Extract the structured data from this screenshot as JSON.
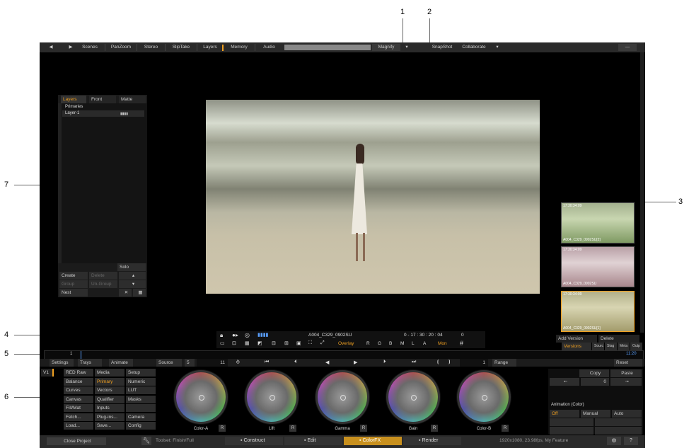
{
  "callouts": [
    "1",
    "2",
    "3",
    "4",
    "5",
    "6",
    "7"
  ],
  "topbar": {
    "items": [
      "Scenes",
      "PanZoom",
      "Stereo",
      "SlipTake",
      "Layers",
      "Memory",
      "Audio"
    ],
    "magnify": "Magnify",
    "snapshot": "SnapShot",
    "collaborate": "Collaborate"
  },
  "layers_panel": {
    "tabs": [
      "Layers",
      "Front",
      "Matte"
    ],
    "rows": [
      "Primaries",
      "Layer-1"
    ],
    "solo": "Solo",
    "create": "Create",
    "delete": "Delete",
    "group": "Group",
    "ungroup": "Un-Group",
    "nest": "Nest"
  },
  "viewer": {
    "clip_name": "A004_C329_0902SU",
    "timecode": "0 - 17 : 30 : 20 : 04",
    "frame": "0",
    "overlay": "Overlay",
    "channels": [
      "R",
      "G",
      "B",
      "M",
      "L",
      "A"
    ],
    "mon": "Mon"
  },
  "versions": {
    "add_version": "Add Version",
    "delete": "Delete",
    "tabs": [
      "Versions",
      "Sourc",
      "Stag",
      "Meta",
      "Outp"
    ],
    "thumbs": [
      {
        "tc": "17:30:34:09",
        "name": "A004_C329_0902SU[2]"
      },
      {
        "tc": "17:30:34:09",
        "name": "A004_C329_0902SU"
      },
      {
        "tc": "17:30:34:09",
        "name": "A004_C329_0902SU[1]"
      }
    ]
  },
  "timeline": {
    "frame": "1",
    "end": "11:20"
  },
  "transport": {
    "tabs": [
      "Settings",
      "Trays",
      "Animate"
    ],
    "source": "Source",
    "source_num": "5",
    "frame": "11",
    "range": "Range",
    "range_num": "1",
    "reset": "Reset"
  },
  "menu": {
    "v1": "V1",
    "grid": [
      [
        "RED Raw",
        "Media",
        "Setup"
      ],
      [
        "Balance",
        "Primary",
        "Numeric"
      ],
      [
        "Curves",
        "Vectors",
        "LUT"
      ],
      [
        "Canvas",
        "Qualifier",
        "Masks"
      ],
      [
        "Fill/Mat",
        "Inputs",
        ""
      ],
      [
        "Fetch...",
        "Plug-ins...",
        "Camera"
      ],
      [
        "Load...",
        "Save...",
        "Config"
      ]
    ]
  },
  "wheels": [
    "Color-A",
    "Lift",
    "Gamma",
    "Gain",
    "Color-B"
  ],
  "right_controls": {
    "copy": "Copy",
    "paste": "Paste",
    "zero": "0",
    "animation": "Animation (Color)",
    "off": "Off",
    "manual": "Manual",
    "auto": "Auto"
  },
  "bottom": {
    "close_project": "Close Project",
    "toolset": "Toolset: Finish/Full",
    "tabs": [
      "Construct",
      "Edit",
      "ColorFX",
      "Render"
    ],
    "info": "1920x1080, 23.98fps, My Feature",
    "help": "?"
  },
  "colors": {
    "accent": "#f0a020"
  }
}
